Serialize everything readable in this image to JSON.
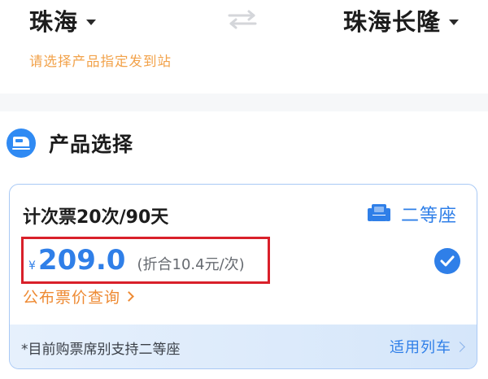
{
  "route": {
    "from_station": "珠海",
    "to_station": "珠海长隆",
    "hint": "请选择产品指定发到站"
  },
  "section": {
    "title": "产品选择"
  },
  "product": {
    "name": "计次票20次/90天",
    "seat_class": "二等座",
    "currency_symbol": "¥",
    "price": "209.0",
    "per_use_price": "(折合10.4元/次)",
    "price_link": "公布票价查询",
    "selected": true,
    "footer_note": "*目前购票席别支持二等座",
    "footer_link": "适用列车"
  },
  "colors": {
    "accent": "#2f7fe8",
    "hint": "#f2a24a",
    "link_orange": "#ee8a33",
    "highlight_box": "#d9202a"
  },
  "icons": {
    "swap": "swap-arrows-icon",
    "section": "train-icon",
    "seat": "seat-icon",
    "selected": "check-circle-icon"
  }
}
